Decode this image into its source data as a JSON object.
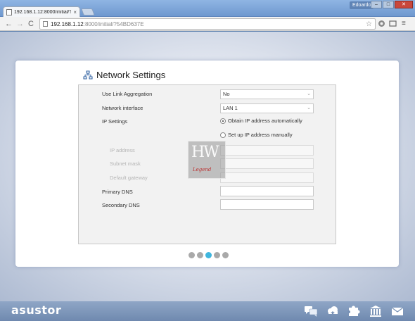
{
  "browser": {
    "tab_title": "192.168.1.12:8000/initial/?",
    "tab_close": "×",
    "user": "Edoardo",
    "win_min": "–",
    "win_max": "□",
    "win_close": "✕",
    "back": "←",
    "forward": "→",
    "reload": "C",
    "url_host": "192.168.1.12",
    "url_rest": ":8000/initial/?54BD637E",
    "star": "☆",
    "menu": "≡"
  },
  "setup": {
    "title": "Network Settings",
    "fields": {
      "link_aggregation": {
        "label": "Use Link Aggregation",
        "value": "No"
      },
      "network_interface": {
        "label": "Network interface",
        "value": "LAN 1"
      },
      "ip_settings": {
        "label": "IP Settings",
        "option_auto": "Obtain IP address automatically",
        "option_manual": "Set up IP address manually",
        "selected": "auto"
      },
      "ip_address": {
        "label": "IP address",
        "value": ""
      },
      "subnet_mask": {
        "label": "Subnet mask",
        "value": ""
      },
      "default_gateway": {
        "label": "Default gateway",
        "value": ""
      },
      "primary_dns": {
        "label": "Primary DNS",
        "value": ""
      },
      "secondary_dns": {
        "label": "Secondary DNS",
        "value": ""
      }
    },
    "pager": {
      "pages": 5,
      "active_index": 2
    }
  },
  "watermark": {
    "mark": "HW",
    "signature": "Legend"
  },
  "footer": {
    "logo": "asustor",
    "icons": [
      "chat-icon",
      "cloud-download-icon",
      "puzzle-icon",
      "bank-icon",
      "mail-icon"
    ]
  },
  "colors": {
    "accent": "#3fb6de",
    "footer": "#7891b5"
  }
}
